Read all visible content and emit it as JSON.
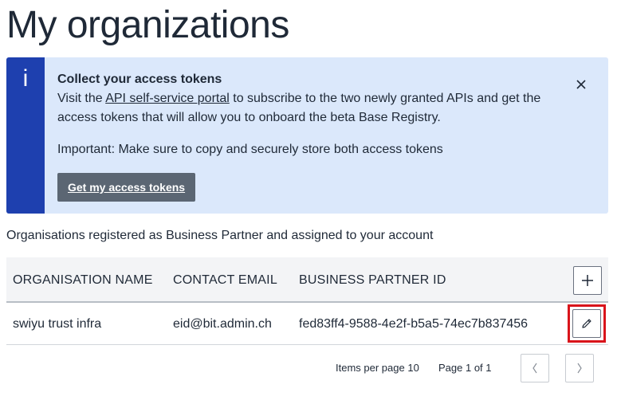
{
  "page": {
    "title": "My organizations"
  },
  "notice": {
    "icon": "info-icon",
    "icon_glyph": "i",
    "title": "Collect your access tokens",
    "text_before_link": "Visit the ",
    "link_text": "API self-service portal",
    "text_after_link": " to subscribe to the two newly granted APIs and get the access tokens that will allow you to onboard the beta Base Registry.",
    "important": "Important: Make sure to copy and securely store both access tokens",
    "button_label": "Get my access tokens",
    "close_icon": "close-icon",
    "colors": {
      "background": "#dbe8fb",
      "accent_bar": "#1e40af",
      "button": "#5b6673"
    }
  },
  "subtitle": "Organisations registered as Business Partner and assigned to your account",
  "table": {
    "columns": [
      "ORGANISATION NAME",
      "CONTACT EMAIL",
      "BUSINESS PARTNER ID"
    ],
    "add_icon": "plus-icon",
    "rows": [
      {
        "name": "swiyu trust infra",
        "email": "eid@bit.admin.ch",
        "partner_id": "fed83ff4-9588-4e2f-b5a5-74ec7b837456",
        "action_icon": "pencil-icon",
        "highlight_color": "#d9141b"
      }
    ]
  },
  "pagination": {
    "items_per_page_label": "Items per page",
    "items_per_page": "10",
    "page_info": "Page 1 of 1",
    "prev_icon": "chevron-left-icon",
    "next_icon": "chevron-right-icon"
  }
}
